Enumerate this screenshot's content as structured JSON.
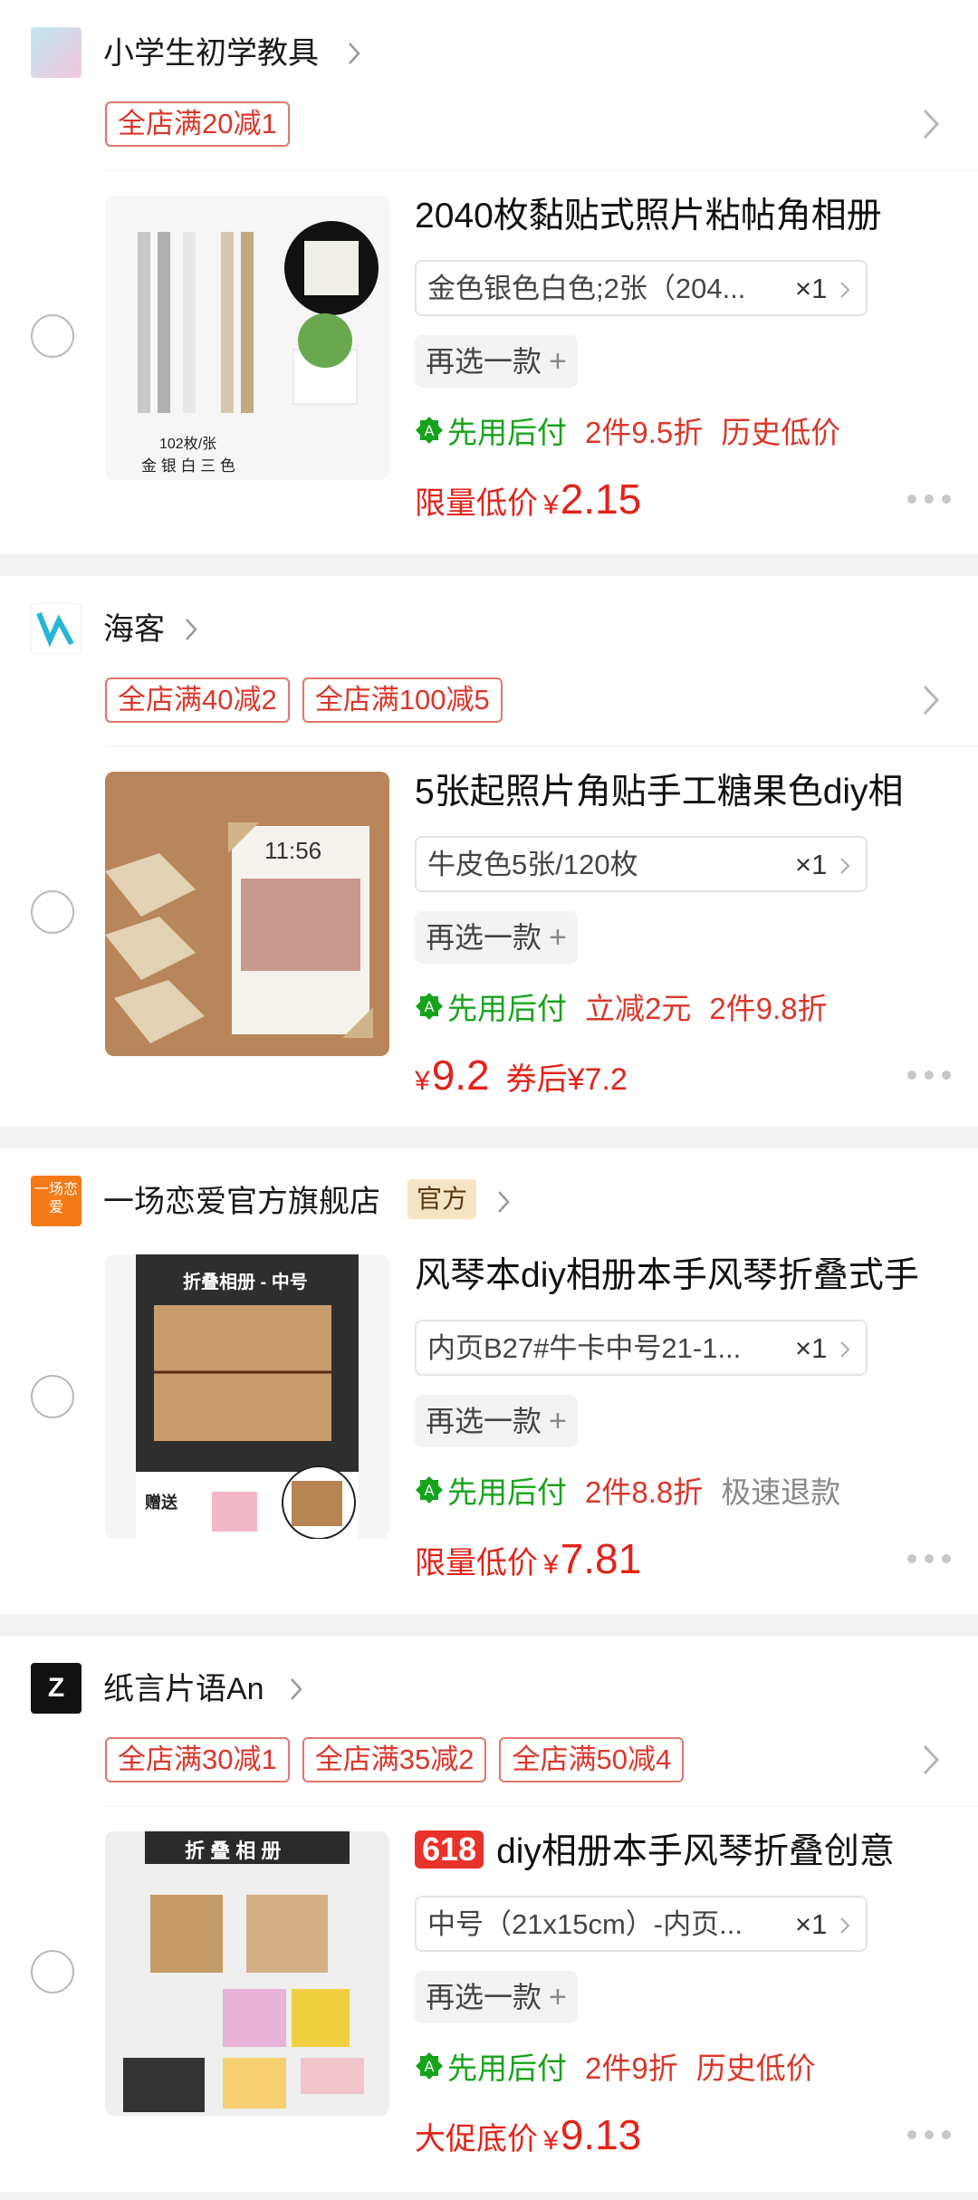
{
  "colors": {
    "accent_red": "#e2231a",
    "tag_border": "#e0776b",
    "bnpl_green": "#17a31c",
    "divider": "#f2f2f2"
  },
  "stores": [
    {
      "name": "小学生初学教具",
      "promos": [
        "全店满20减1"
      ],
      "item": {
        "title": "2040枚黏贴式照片粘帖角相册",
        "sku": "金色银色白色;2张（204...",
        "qty": "×1",
        "reselect": "再选一款",
        "bnpl": "先用后付",
        "benefits": [
          "2件9.5折",
          "历史低价"
        ],
        "price_label": "限量低价",
        "currency": "¥",
        "price": "2.15",
        "thumb_caption1": "102枚/张",
        "thumb_caption2": "金 银 白 三 色"
      }
    },
    {
      "name": "海客",
      "promos": [
        "全店满40减2",
        "全店满100减5"
      ],
      "item": {
        "title": "5张起照片角贴手工糖果色diy相",
        "sku": "牛皮色5张/120枚",
        "qty": "×1",
        "reselect": "再选一款",
        "bnpl": "先用后付",
        "benefits": [
          "立减2元",
          "2件9.8折"
        ],
        "currency": "¥",
        "price": "9.2",
        "price_after": "券后¥7.2",
        "thumb_caption1": "11:56"
      }
    },
    {
      "name": "一场恋爱官方旗舰店",
      "logo_text": "一场恋爱",
      "official": "官方",
      "promos": [],
      "item": {
        "title": "风琴本diy相册本手风琴折叠式手",
        "sku": "内页B27#牛卡中号21-1...",
        "qty": "×1",
        "reselect": "再选一款",
        "bnpl": "先用后付",
        "benefits": [
          "2件8.8折"
        ],
        "benefit_gray": "极速退款",
        "price_label": "限量低价",
        "currency": "¥",
        "price": "7.81",
        "thumb_caption1": "折叠相册 - 中号",
        "thumb_caption2": "赠送"
      }
    },
    {
      "name": "纸言片语An",
      "logo_text": "Z",
      "promos": [
        "全店满30减1",
        "全店满35减2",
        "全店满50减4"
      ],
      "item": {
        "badge": "618",
        "title": "diy相册本手风琴折叠创意",
        "sku": "中号（21x15cm）-内页...",
        "qty": "×1",
        "reselect": "再选一款",
        "bnpl": "先用后付",
        "benefits": [
          "2件9折",
          "历史低价"
        ],
        "price_label": "大促底价",
        "currency": "¥",
        "price": "9.13",
        "thumb_caption1": "折 叠 相 册"
      }
    }
  ]
}
